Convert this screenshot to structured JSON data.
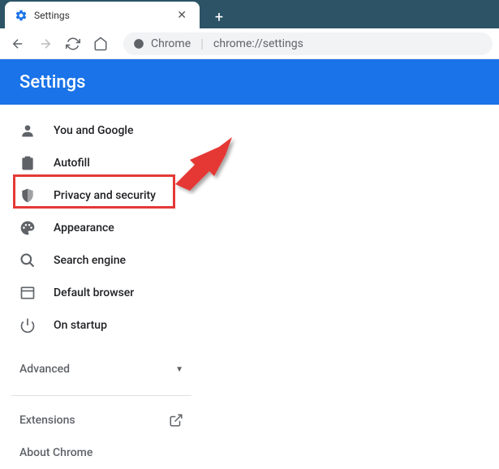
{
  "tab": {
    "title": "Settings"
  },
  "omnibox": {
    "host": "Chrome",
    "url": "chrome://settings"
  },
  "header": {
    "title": "Settings"
  },
  "menu": {
    "you": "You and Google",
    "autofill": "Autofill",
    "privacy": "Privacy and security",
    "appearance": "Appearance",
    "search": "Search engine",
    "browser": "Default browser",
    "startup": "On startup"
  },
  "advanced": {
    "label": "Advanced"
  },
  "extensions": {
    "label": "Extensions"
  },
  "about": {
    "label": "About Chrome"
  },
  "highlight_color": "#e53935",
  "arrow_color": "#e53935"
}
